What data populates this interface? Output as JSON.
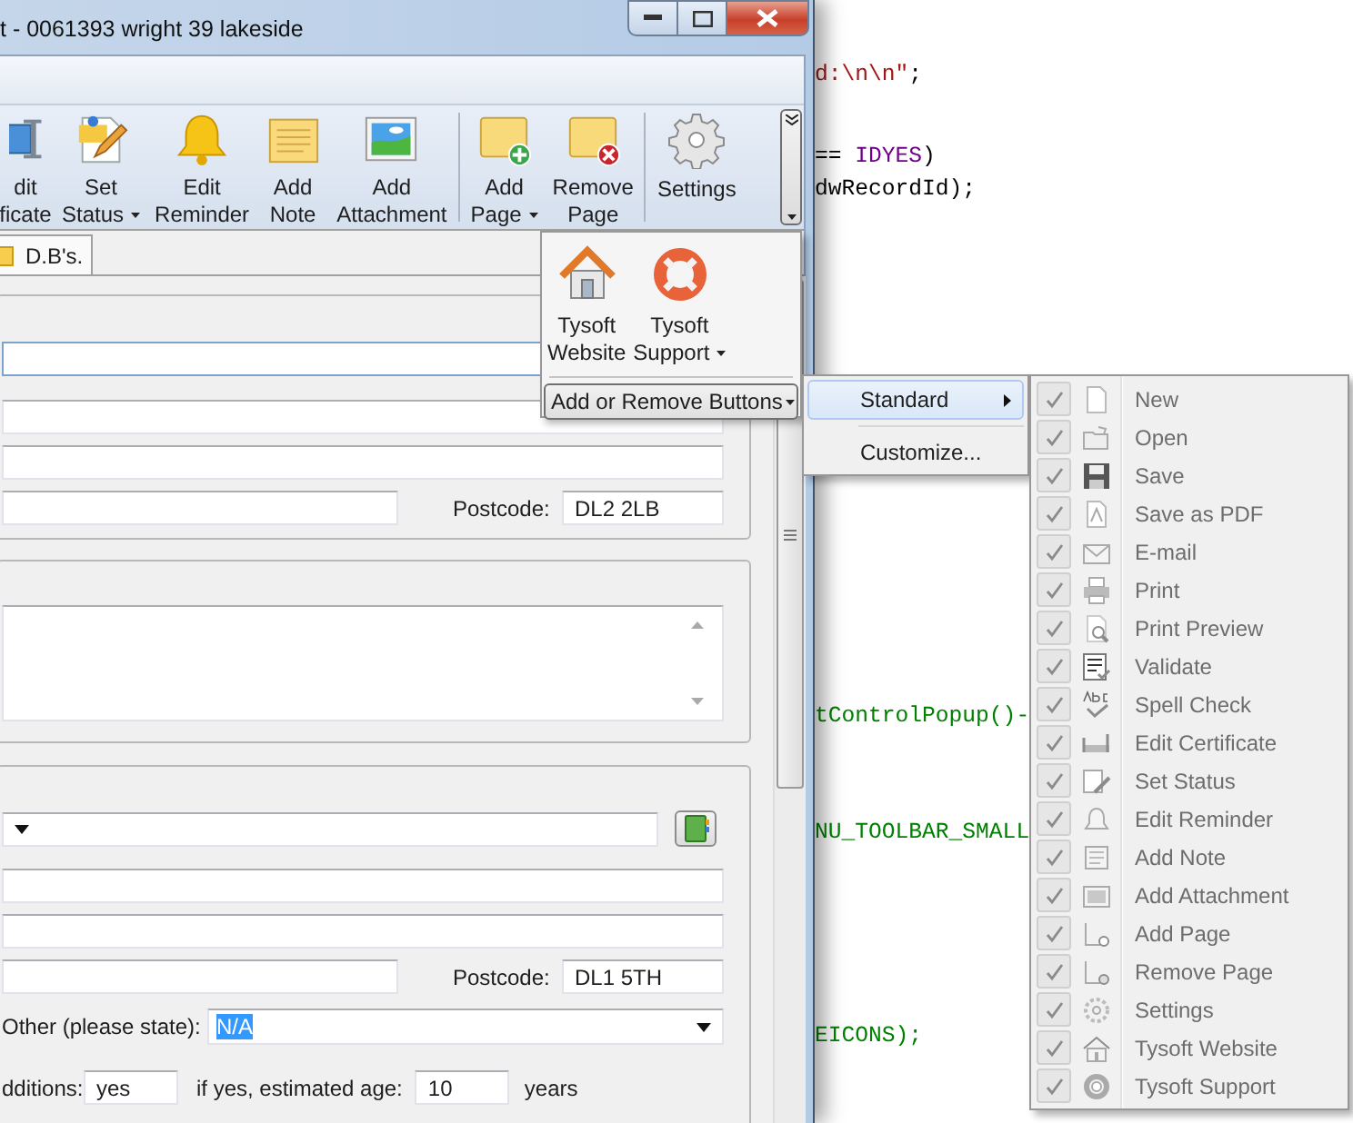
{
  "window": {
    "title": "t - 0061393 wright 39 lakeside"
  },
  "toolbar": {
    "items": [
      {
        "kind": "button",
        "lines": [
          "dit",
          "ficate"
        ],
        "dropdown": false
      },
      {
        "kind": "button",
        "lines": [
          "Set",
          "Status"
        ],
        "dropdown": true
      },
      {
        "kind": "button",
        "lines": [
          "Edit",
          "Reminder"
        ],
        "dropdown": false
      },
      {
        "kind": "button",
        "lines": [
          "Add",
          "Note"
        ],
        "dropdown": false
      },
      {
        "kind": "button",
        "lines": [
          "Add",
          "Attachment"
        ],
        "dropdown": false
      },
      {
        "kind": "separator"
      },
      {
        "kind": "button",
        "lines": [
          "Add",
          "Page"
        ],
        "dropdown": true
      },
      {
        "kind": "button",
        "lines": [
          "Remove",
          "Page"
        ],
        "dropdown": false
      },
      {
        "kind": "separator"
      },
      {
        "kind": "button",
        "lines": [
          "Settings"
        ],
        "dropdown": false
      }
    ]
  },
  "tabs": [
    {
      "label": "D.B's.",
      "selected": true
    }
  ],
  "form": {
    "postcode_1": {
      "label": "Postcode:",
      "value": "DL2 2LB"
    },
    "postcode_2": {
      "label": "Postcode:",
      "value": "DL1 5TH"
    },
    "other": {
      "label": "Other (please state):",
      "value": "N/A",
      "value_selected": true
    },
    "additions": {
      "label": "dditions:",
      "value": "yes"
    },
    "estimated_age": {
      "label": "if yes, estimated age:",
      "value": "10",
      "unit": "years"
    }
  },
  "overflow_popup": {
    "buttons": [
      {
        "lines": [
          "Tysoft",
          "Website"
        ],
        "dropdown": false
      },
      {
        "lines": [
          "Tysoft",
          "Support"
        ],
        "dropdown": true
      }
    ],
    "add_remove": {
      "label": "Add or Remove Buttons",
      "dropdown": true
    }
  },
  "submenu": {
    "items": [
      {
        "label": "Standard",
        "has_submenu": true,
        "selected": true
      },
      {
        "label": "Customize...",
        "has_submenu": false,
        "selected": false
      }
    ]
  },
  "buttons_menu": {
    "items": [
      {
        "label": "New",
        "checked": true
      },
      {
        "label": "Open",
        "checked": true
      },
      {
        "label": "Save",
        "checked": true
      },
      {
        "label": "Save as PDF",
        "checked": true
      },
      {
        "label": "E-mail",
        "checked": true
      },
      {
        "label": "Print",
        "checked": true
      },
      {
        "label": "Print Preview",
        "checked": true
      },
      {
        "label": "Validate",
        "checked": true
      },
      {
        "label": "Spell Check",
        "checked": true
      },
      {
        "label": "Edit Certificate",
        "checked": true
      },
      {
        "label": "Set Status",
        "checked": true
      },
      {
        "label": "Edit Reminder",
        "checked": true
      },
      {
        "label": "Add Note",
        "checked": true
      },
      {
        "label": "Add Attachment",
        "checked": true
      },
      {
        "label": "Add Page",
        "checked": true
      },
      {
        "label": "Remove Page",
        "checked": true
      },
      {
        "label": "Settings",
        "checked": true
      },
      {
        "label": "Tysoft Website",
        "checked": true
      },
      {
        "label": "Tysoft Support",
        "checked": true
      }
    ]
  },
  "code_editor": {
    "lines": [
      {
        "segments": [
          {
            "kind": "string",
            "text": "d:\\n\\n\""
          },
          {
            "kind": "plain",
            "text": ";"
          }
        ]
      },
      {
        "segments": [
          {
            "kind": "plain",
            "text": "== "
          },
          {
            "kind": "macro",
            "text": "IDYES"
          },
          {
            "kind": "plain",
            "text": ")"
          }
        ]
      },
      {
        "segments": [
          {
            "kind": "plain",
            "text": "dwRecordId);"
          }
        ]
      },
      {
        "segments": [
          {
            "kind": "comment",
            "text": "tControlPopup()-"
          }
        ]
      },
      {
        "segments": [
          {
            "kind": "comment",
            "text": "NU_TOOLBAR_SMALL"
          }
        ]
      },
      {
        "segments": [
          {
            "kind": "comment",
            "text": "EICONS);"
          }
        ]
      }
    ]
  }
}
